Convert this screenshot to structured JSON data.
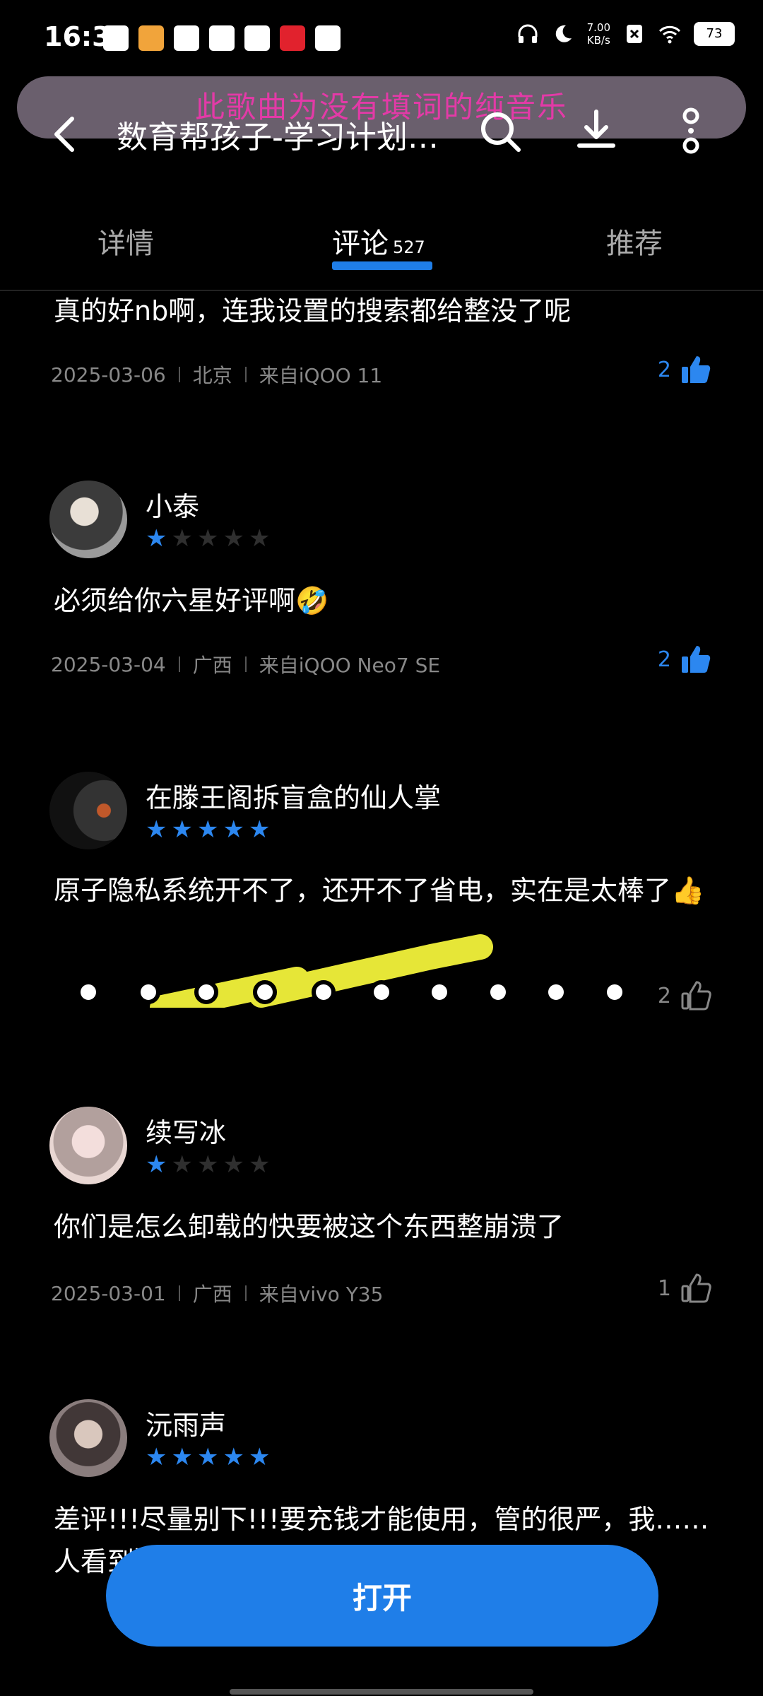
{
  "status_bar": {
    "time": "16:32",
    "net_speed_value": "7.00",
    "net_speed_unit": "KB/s",
    "battery": "73"
  },
  "lyric_banner": "此歌曲为没有填词的纯音乐",
  "toolbar": {
    "title": "数育帮孩子-学习计划…"
  },
  "tabs": [
    {
      "label": "详情"
    },
    {
      "label": "评论",
      "count": "527"
    },
    {
      "label": "推荐"
    }
  ],
  "comments": [
    {
      "text": "真的好nb啊，连我设置的搜索都给整没了呢",
      "date": "2025-03-06",
      "region": "北京",
      "device": "来自iQOO 11",
      "likes": "2"
    },
    {
      "username": "小泰",
      "rating": 1,
      "text": "必须给你六星好评啊🤣",
      "date": "2025-03-04",
      "region": "广西",
      "device": "来自iQOO Neo7 SE",
      "likes": "2"
    },
    {
      "username": "在滕王阁拆盲盒的仙人掌",
      "rating": 5,
      "text": "原子隐私系统开不了，还开不了省电，实在是太棒了👍",
      "likes": "2"
    },
    {
      "username": "续写冰",
      "rating": 1,
      "text": "你们是怎么卸载的快要被这个东西整崩溃了",
      "date": "2025-03-01",
      "region": "广西",
      "device": "来自vivo Y35",
      "likes": "1"
    },
    {
      "username": "沅雨声",
      "rating": 5,
      "text": "差评!!!尽量别下!!!要充钱才能使用，管的很严，我……人看到）"
    }
  ],
  "open_button": "打开"
}
